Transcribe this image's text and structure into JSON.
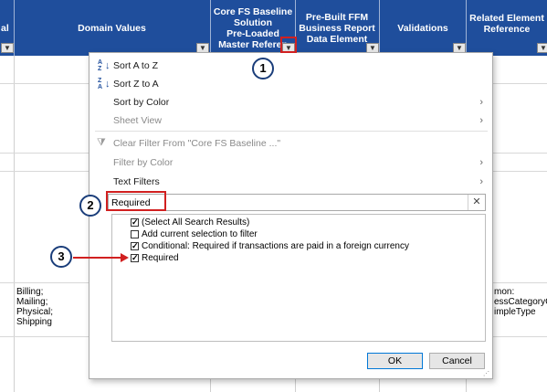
{
  "header": {
    "columns": [
      {
        "label": "al"
      },
      {
        "label": "Domain Values"
      },
      {
        "label": "Core FS Baseline\nSolution\nPre-Loaded\nMaster Referen"
      },
      {
        "label": "Pre-Built FFM\nBusiness Report\nData Element"
      },
      {
        "label": "Validations"
      },
      {
        "label": "Related Element\nReference"
      }
    ]
  },
  "grid": {
    "domain_values_cell": "Billing;\nMailing;\nPhysical;\nShipping",
    "related_cell": "mon:\nessCategoryC\nimpleType"
  },
  "menu": {
    "sort_a_to_z": "Sort A to Z",
    "sort_z_to_a": "Sort Z to A",
    "sort_by_color": "Sort by Color",
    "sheet_view": "Sheet View",
    "clear_filter": "Clear Filter From \"Core FS Baseline ...\"",
    "filter_by_color": "Filter by Color",
    "text_filters": "Text Filters",
    "search_value": "Required",
    "list_items": [
      {
        "label": "(Select All Search Results)",
        "checked": true
      },
      {
        "label": "Add current selection to filter",
        "checked": false
      },
      {
        "label": "Conditional: Required if transactions are paid in a foreign currency",
        "checked": true
      },
      {
        "label": "Required",
        "checked": true
      }
    ],
    "ok_label": "OK",
    "cancel_label": "Cancel"
  },
  "callouts": {
    "one": "1",
    "two": "2",
    "three": "3"
  },
  "colors": {
    "header_bg": "#1f4e9c",
    "callout_red": "#d12020",
    "callout_circle": "#1a3d7a"
  }
}
